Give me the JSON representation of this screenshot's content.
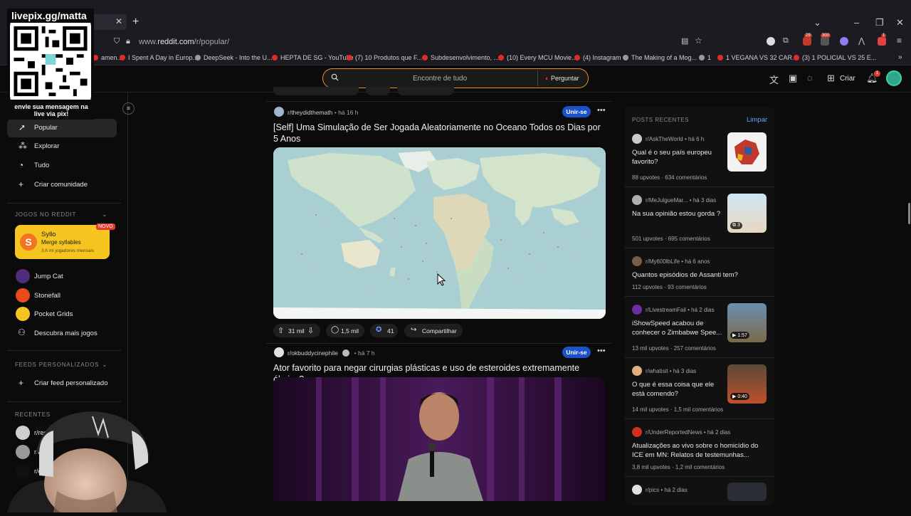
{
  "browser": {
    "url_prefix": "www.",
    "url_domain": "reddit.com",
    "url_path": "/r/popular/",
    "bookmarks": [
      "amen...",
      "I Spent A Day in Europ...",
      "DeepSeek - Into the U...",
      "HEPTA DE SG - YouTube",
      "(7) 10 Produtos que F...",
      "Subdesenvolvimento, ...",
      "(10) Every MCU Movie...",
      "(4) Instagram",
      "The Making of a Mog...",
      "1",
      "1 VEGANA VS 32 CAR...",
      "(3) 1 POLICIAL VS 25 E..."
    ],
    "ext_badges": [
      "29",
      "300",
      "1"
    ]
  },
  "header": {
    "search_placeholder": "Encontre de tudo",
    "ask_label": "Perguntar",
    "create_label": "Criar",
    "notif_count": "1"
  },
  "sidebar": {
    "nav": [
      {
        "label": "Popular",
        "icon": "popular-icon"
      },
      {
        "label": "Explorar",
        "icon": "explore-icon"
      },
      {
        "label": "Tudo",
        "icon": "all-icon"
      },
      {
        "label": "Criar comunidade",
        "icon": "plus-icon"
      }
    ],
    "games_section": "JOGOS NO REDDIT",
    "featured_game": {
      "name": "Syllo",
      "subtitle": "Merge syllables",
      "players": "3,6 mi jogadores mensais",
      "badge": "NOVO"
    },
    "games": [
      "Jump Cat",
      "Stonefall",
      "Pocket Grids",
      "Descubra mais jogos"
    ],
    "feeds_section": "FEEDS PERSONALIZADOS",
    "create_feed": "Criar feed personalizado",
    "recent_section": "RECENTES",
    "recents": [
      "r/recl...macc",
      "r/Me...",
      "r/c..."
    ]
  },
  "feed": {
    "post1": {
      "subreddit": "r/theydidthemath",
      "time": "há 16 h",
      "join": "Unir-se",
      "title": "[Self] Uma Simulação de Ser Jogada Aleatoriamente no Oceano Todos os Dias por 5 Anos",
      "upvotes": "31 mil",
      "comments": "1,5 mil",
      "awards": "41",
      "share": "Compartilhar"
    },
    "post2": {
      "subreddit": "r/okbuddycinephile",
      "time": "há 7 h",
      "join": "Unir-se",
      "title": "Ator favorito para negar cirurgias plásticas e uso de esteroides extremamente óbvios?"
    }
  },
  "recent_posts": {
    "title": "POSTS RECENTES",
    "clear": "Limpar",
    "items": [
      {
        "sub": "r/AskTheWorld",
        "time": "há 6 h",
        "title": "Qual é o seu país europeu favorito?",
        "upvotes": "88 upvotes",
        "comments": "634 comentários"
      },
      {
        "sub": "r/MeJulgueMar...",
        "time": "há 3 dias",
        "title": "Na sua opinião estou gorda ?",
        "upvotes": "501 upvotes",
        "comments": "695 comentários",
        "badge": "3"
      },
      {
        "sub": "r/My600lbLife",
        "time": "há 6 anos",
        "title": "Quantos episódios de Assanti tem?",
        "upvotes": "112 upvotes",
        "comments": "93 comentários"
      },
      {
        "sub": "r/LivestreamFail",
        "time": "há 2 dias",
        "title": "iShowSpeed acabou de conhecer o Zimbabwe Spee...",
        "upvotes": "13 mil upvotes",
        "comments": "257 comentários",
        "badge": "1:57"
      },
      {
        "sub": "r/whatisit",
        "time": "há 3 dias",
        "title": "O que é essa coisa que ele está comendo?",
        "upvotes": "14 mil upvotes",
        "comments": "1,5 mil comentários",
        "badge": "0:40"
      },
      {
        "sub": "r/UnderReportedNews",
        "time": "há 2 dias",
        "title": "Atualizações ao vivo sobre o homicídio do ICE em MN: Relatos de testemunhas...",
        "upvotes": "3,8 mil upvotes",
        "comments": "1,2 mil comentários"
      },
      {
        "sub": "r/pics",
        "time": "há 2 dias"
      }
    ]
  },
  "overlay": {
    "stream_handle": "livepix.gg/matta",
    "qr_caption": "envie sua mensagem na live via pix!"
  },
  "colors": {
    "accent": "#1a52c8",
    "orange": "#e88f2c",
    "link": "#6aa2ff"
  }
}
